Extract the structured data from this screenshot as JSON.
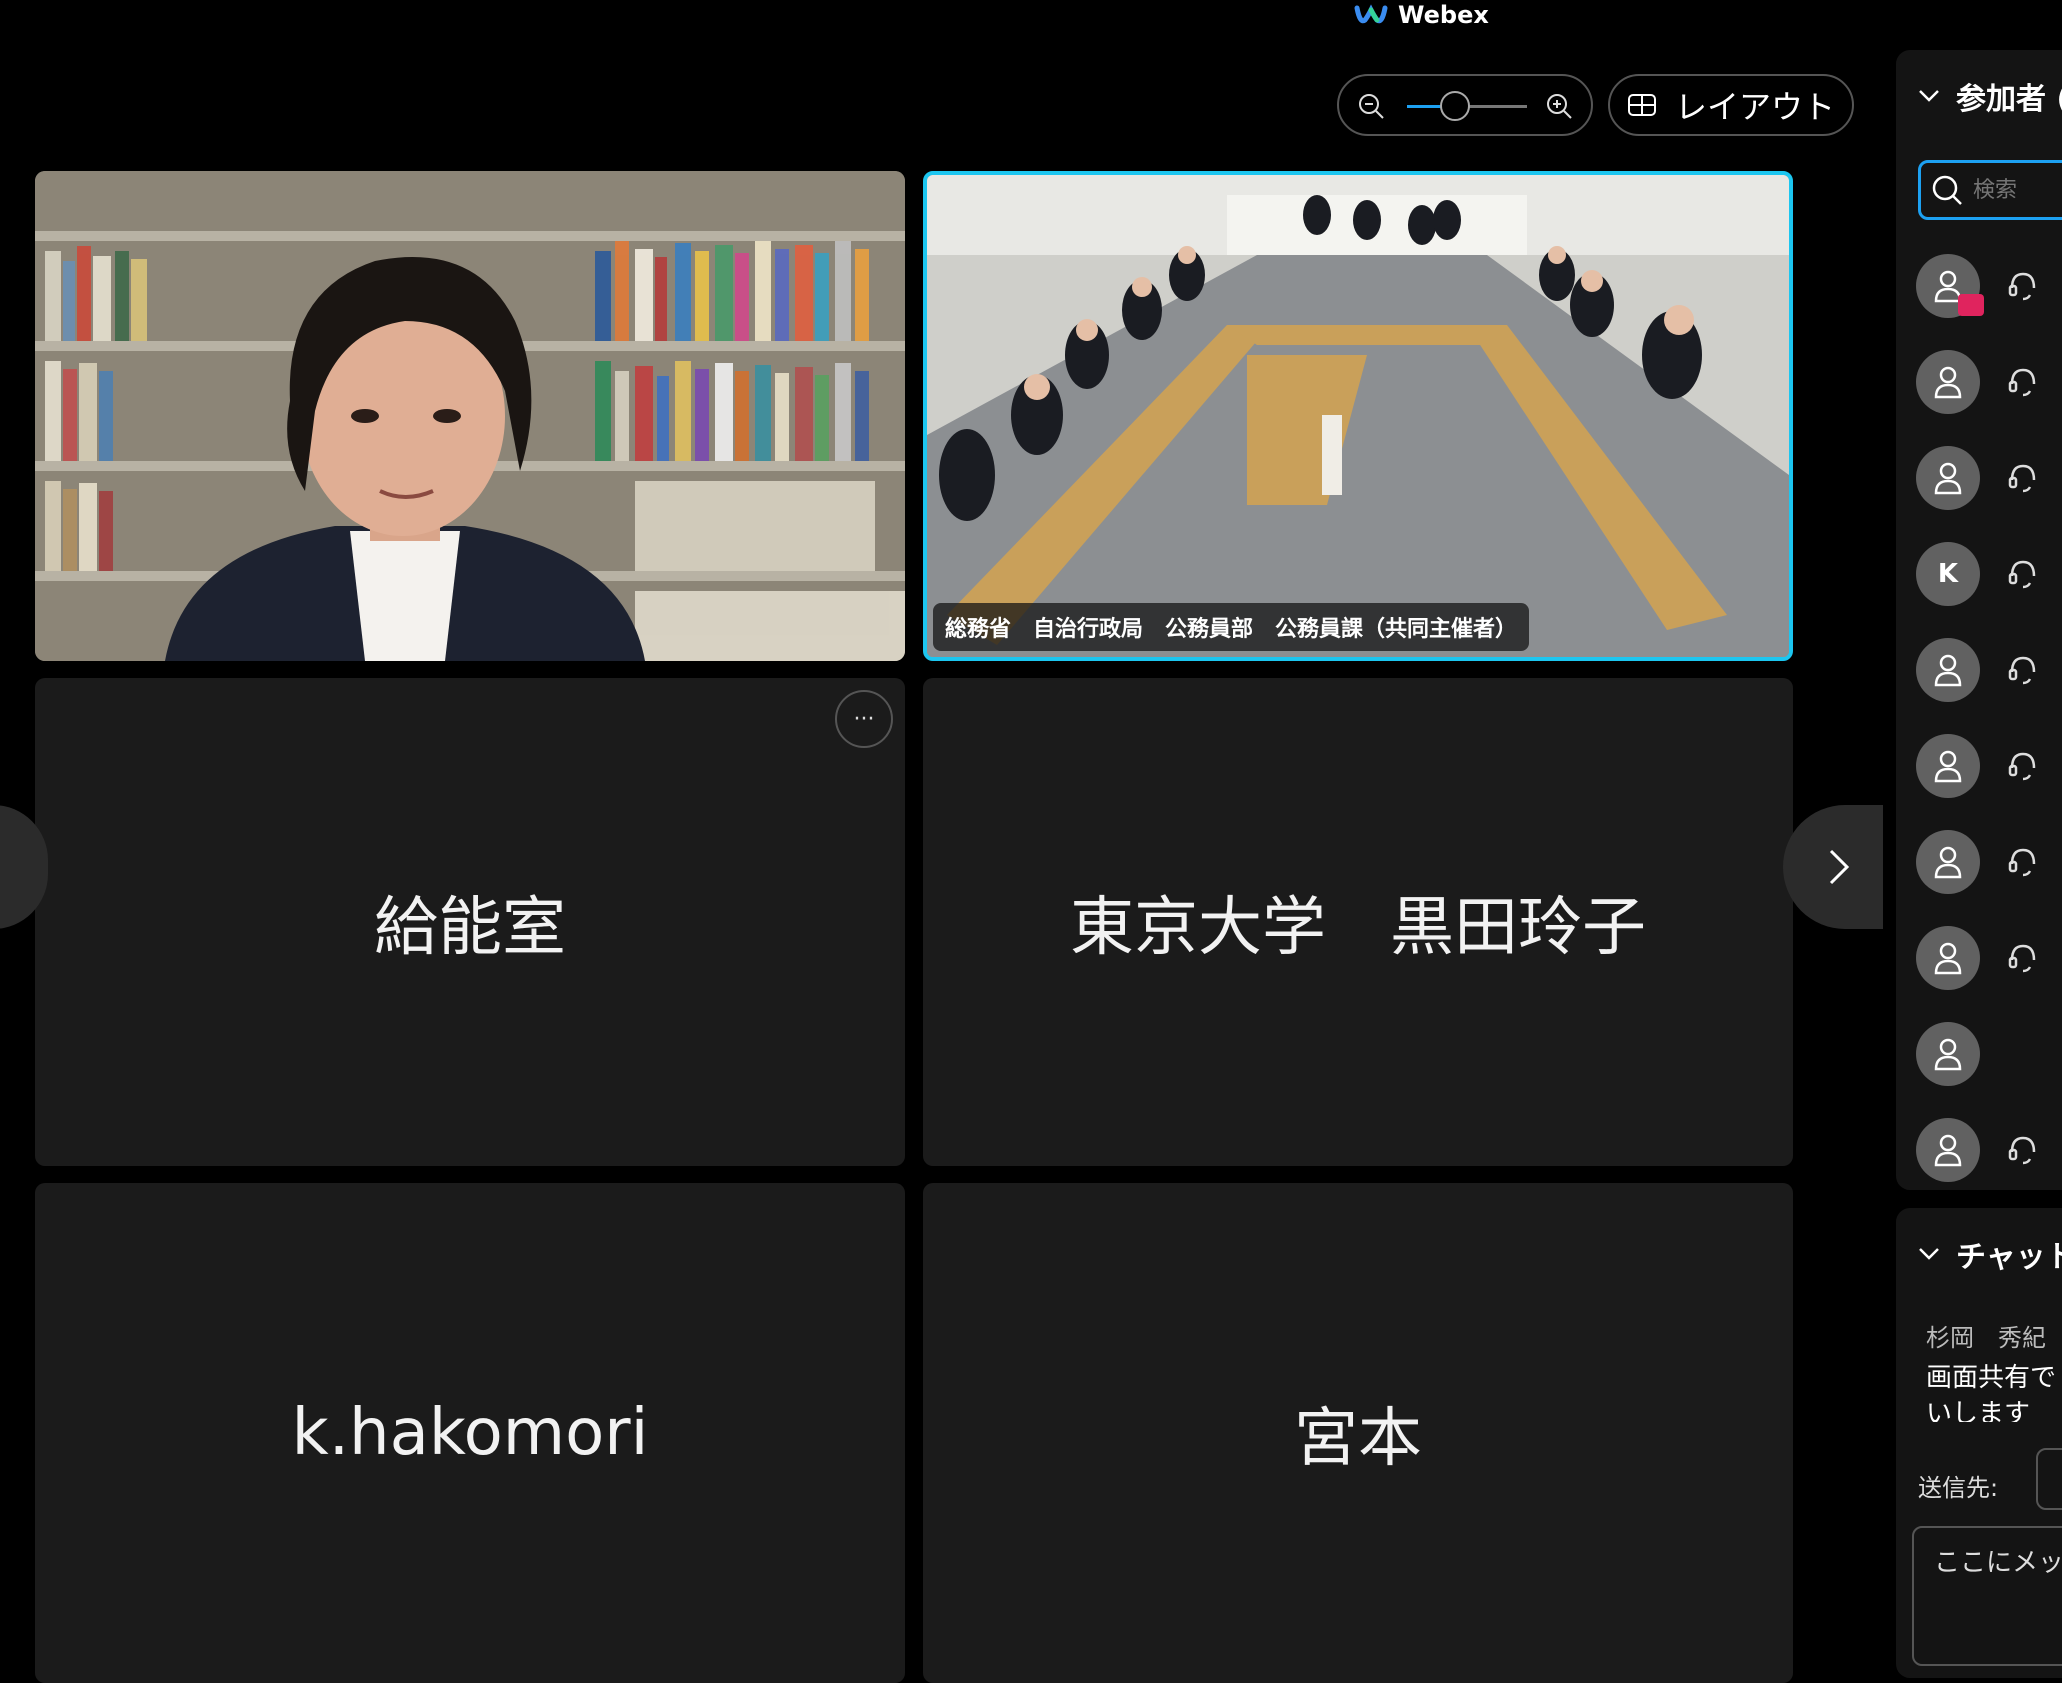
{
  "app": {
    "title": "Webex"
  },
  "toolbar": {
    "layout_label": "レイアウト",
    "zoom_percent": 40
  },
  "tiles": [
    {
      "name": "",
      "video": true
    },
    {
      "name": "",
      "video": true,
      "label": "総務省　自治行政局　公務員部　公務員課（共同主催者）"
    },
    {
      "name": "給能室"
    },
    {
      "name": "東京大学　黒田玲子"
    },
    {
      "name": "k.hakomori"
    },
    {
      "name": "宮本"
    }
  ],
  "more_button": "···",
  "participants": {
    "title": "参加者 (",
    "search_placeholder": "検索",
    "items": [
      {
        "initial": "",
        "sharing": true
      },
      {
        "initial": ""
      },
      {
        "initial": ""
      },
      {
        "initial": "K"
      },
      {
        "initial": ""
      },
      {
        "initial": ""
      },
      {
        "initial": ""
      },
      {
        "initial": ""
      },
      {
        "initial": ""
      },
      {
        "initial": ""
      }
    ]
  },
  "chat": {
    "title": "チャット",
    "sender": "杉岡　秀紀",
    "message": "画面共有で\nいします",
    "to_label": "送信先:",
    "input_placeholder": "ここにメッ"
  }
}
